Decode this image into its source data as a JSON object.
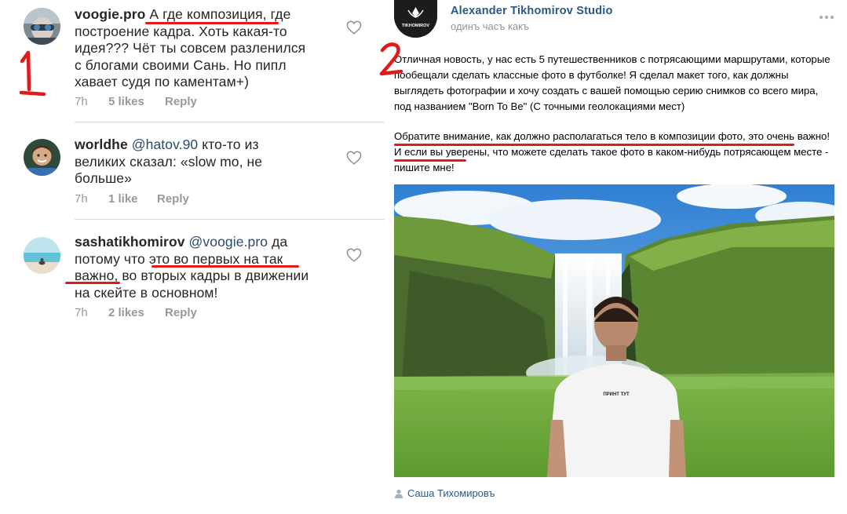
{
  "comments": [
    {
      "username": "voogie.pro",
      "text_highlight": "А где композиция",
      "text_rest": ", где построение кадра. Хоть какая-то идея??? Чёт ты совсем разленился с блогами своими Сань. Но пипл хавает судя по каментам+)",
      "time": "7h",
      "likes": "5 likes",
      "reply": "Reply"
    },
    {
      "username": "worldhe",
      "mention": "@hatov.90",
      "text_rest": " кто-то из великих сказал: «slow mo, не больше»",
      "time": "7h",
      "likes": "1 like",
      "reply": "Reply"
    },
    {
      "username": "sashatikhomirov",
      "mention": "@voogie.pro",
      "text_before": " да потому что ",
      "text_highlight": "это во первых на так важно",
      "text_rest": ", во вторых кадры в движении на скейте в основном!",
      "time": "7h",
      "likes": "2 likes",
      "reply": "Reply"
    }
  ],
  "annotations": {
    "left_number": "1",
    "right_number": "2",
    "color": "#e31a1a"
  },
  "post": {
    "author": "Alexander Tikhomirov Studio",
    "time": "одинъ часъ какъ",
    "avatar_logo_text": "TIKHOMIROV",
    "paragraph1": "Отличная новость, у нас есть 5 путешественников с потрясающими маршрутами, которые пообещали сделать классные фото в футболке! Я сделал макет того, как должны выглядеть фотографии и хочу создать с вашей помощью серию снимков со всего мира, под названием \"Born To Be\" (С точными геолокациями мест)",
    "paragraph2_highlight": "Обратите внимание, как должно располагаться тело в композиции фото, это очень важно",
    "paragraph2_rest": "! И если вы уверены, что можете сделать такое фото в каком-нибудь потрясающем месте - пишите мне!",
    "shirt_text": "ПРИНТ ТУТ",
    "signer": "Саша Тихомировъ"
  },
  "icons": [
    "heart-icon",
    "more-dots-icon",
    "person-icon"
  ],
  "colors": {
    "text": "#262626",
    "meta": "#999999",
    "vk_link": "#2a5885",
    "separator": "#dbdbdb"
  }
}
